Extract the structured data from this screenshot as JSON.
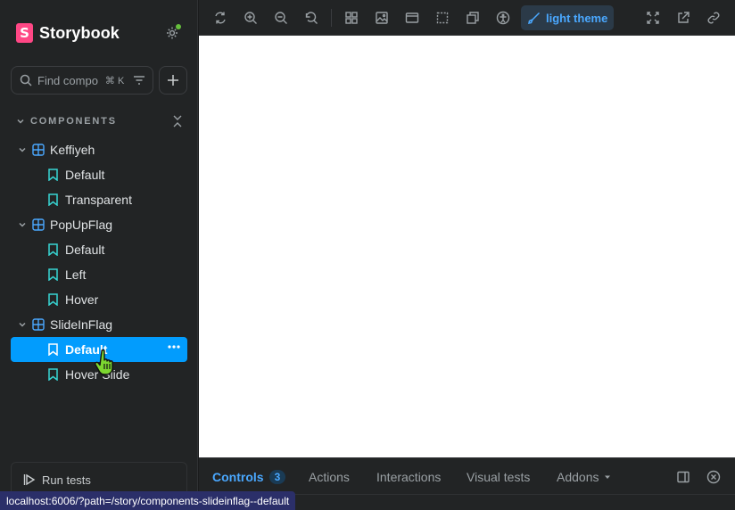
{
  "brand": {
    "name": "Storybook",
    "logo_letter": "S"
  },
  "search": {
    "placeholder": "Find compo",
    "shortcut": "⌘ K"
  },
  "section": {
    "label": "COMPONENTS"
  },
  "tree": [
    {
      "type": "group",
      "label": "Keffiyeh"
    },
    {
      "type": "story",
      "label": "Default"
    },
    {
      "type": "story",
      "label": "Transparent"
    },
    {
      "type": "group",
      "label": "PopUpFlag"
    },
    {
      "type": "story",
      "label": "Default"
    },
    {
      "type": "story",
      "label": "Left"
    },
    {
      "type": "story",
      "label": "Hover"
    },
    {
      "type": "group",
      "label": "SlideInFlag"
    },
    {
      "type": "story",
      "label": "Default",
      "selected": true
    },
    {
      "type": "story",
      "label": "Hover Slide"
    }
  ],
  "sidebar_footer": {
    "run_tests": "Run tests"
  },
  "status_bar": {
    "url": "localhost:6006/?path=/story/components-slideinflag--default"
  },
  "toolbar": {
    "icons": [
      "remount-icon",
      "zoom-in-icon",
      "zoom-out-icon",
      "reset-zoom-icon",
      "grid-icon",
      "background-icon",
      "viewport-icon",
      "outline-icon",
      "measure-icon",
      "accessibility-icon"
    ],
    "theme_label": "light theme"
  },
  "panel": {
    "tabs": [
      {
        "label": "Controls",
        "badge": "3",
        "active": true
      },
      {
        "label": "Actions"
      },
      {
        "label": "Interactions"
      },
      {
        "label": "Visual tests"
      },
      {
        "label": "Addons"
      }
    ]
  },
  "colors": {
    "accent": "#029cfd",
    "brand": "#ff4785",
    "status_ok": "#66bf3c"
  }
}
